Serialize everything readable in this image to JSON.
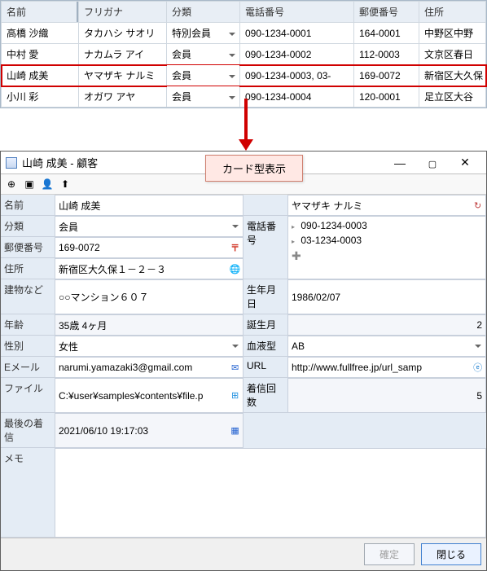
{
  "grid": {
    "headers": [
      "名前",
      "フリガナ",
      "分類",
      "電話番号",
      "郵便番号",
      "住所"
    ],
    "rows": [
      {
        "name": "高橋 沙織",
        "kana": "タカハシ サオリ",
        "type": "特別会員",
        "phone": "090-1234-0001",
        "zip": "164-0001",
        "addr": "中野区中野"
      },
      {
        "name": "中村 愛",
        "kana": "ナカムラ アイ",
        "type": "会員",
        "phone": "090-1234-0002",
        "zip": "112-0003",
        "addr": "文京区春日"
      },
      {
        "name": "山崎 成美",
        "kana": "ヤマザキ ナルミ",
        "type": "会員",
        "phone": "090-1234-0003, 03-",
        "zip": "169-0072",
        "addr": "新宿区大久保"
      },
      {
        "name": "小川 彩",
        "kana": "オガワ アヤ",
        "type": "会員",
        "phone": "090-1234-0004",
        "zip": "120-0001",
        "addr": "足立区大谷"
      }
    ]
  },
  "callout": "カード型表示",
  "card": {
    "title": "山崎 成美 - 顧客",
    "labels": {
      "name": "名前",
      "type": "分類",
      "zip": "郵便番号",
      "addr": "住所",
      "bldg": "建物など",
      "age": "年齢",
      "sex": "性別",
      "email": "Eメール",
      "file": "ファイル",
      "last": "最後の着信",
      "memo": "メモ",
      "furigana_blank": "",
      "phone": "電話番号",
      "birth": "生年月日",
      "bmonth": "誕生月",
      "blood": "血液型",
      "url": "URL",
      "calls": "着信回数"
    },
    "values": {
      "name": "山崎 成美",
      "furigana": "ヤマザキ ナルミ",
      "type": "会員",
      "zip": "169-0072",
      "addr": "新宿区大久保１－２－３",
      "bldg": "○○マンション６０７",
      "age": "35歳 4ヶ月",
      "sex": "女性",
      "email": "narumi.yamazaki3@gmail.com",
      "file": "C:¥user¥samples¥contents¥file.p",
      "last": "2021/06/10 19:17:03",
      "phones": [
        "090-1234-0003",
        "03-1234-0003"
      ],
      "birth": "1986/02/07",
      "bmonth": "2",
      "blood": "AB",
      "url": "http://www.fullfree.jp/url_samp",
      "calls": "5"
    },
    "buttons": {
      "confirm": "確定",
      "close": "閉じる"
    }
  }
}
